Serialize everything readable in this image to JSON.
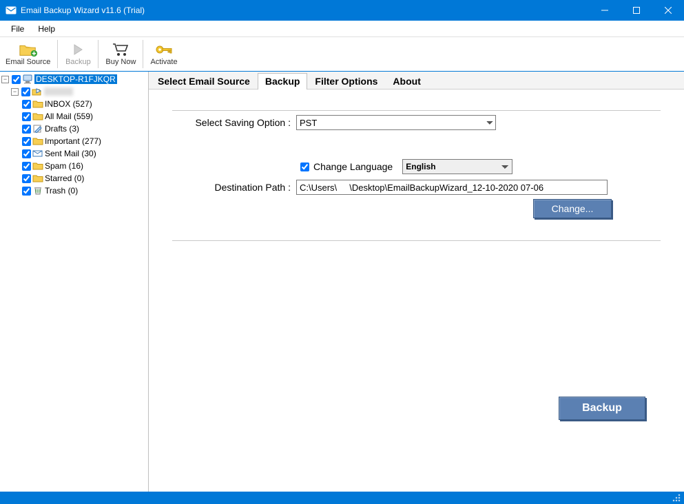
{
  "window": {
    "title": "Email Backup Wizard v11.6 (Trial)"
  },
  "menu": {
    "file": "File",
    "help": "Help"
  },
  "toolbar": {
    "email_source": "Email Source",
    "backup": "Backup",
    "buy_now": "Buy Now",
    "activate": "Activate"
  },
  "tree": {
    "root": "DESKTOP-R1FJKQR",
    "account": "",
    "items": [
      {
        "label": "INBOX (527)"
      },
      {
        "label": "All Mail (559)"
      },
      {
        "label": "Drafts (3)"
      },
      {
        "label": "Important (277)"
      },
      {
        "label": "Sent Mail (30)"
      },
      {
        "label": "Spam (16)"
      },
      {
        "label": "Starred (0)"
      },
      {
        "label": "Trash (0)"
      }
    ]
  },
  "tabs": {
    "select": "Select Email Source",
    "backup": "Backup",
    "filter": "Filter Options",
    "about": "About"
  },
  "form": {
    "saving_label": "Select Saving Option :",
    "saving_value": "PST",
    "change_lang_label": "Change Language",
    "lang_value": "English",
    "dest_label": "Destination Path :",
    "dest_value": "C:\\Users\\     \\Desktop\\EmailBackupWizard_12-10-2020 07-06",
    "change_btn": "Change...",
    "backup_btn": "Backup"
  }
}
